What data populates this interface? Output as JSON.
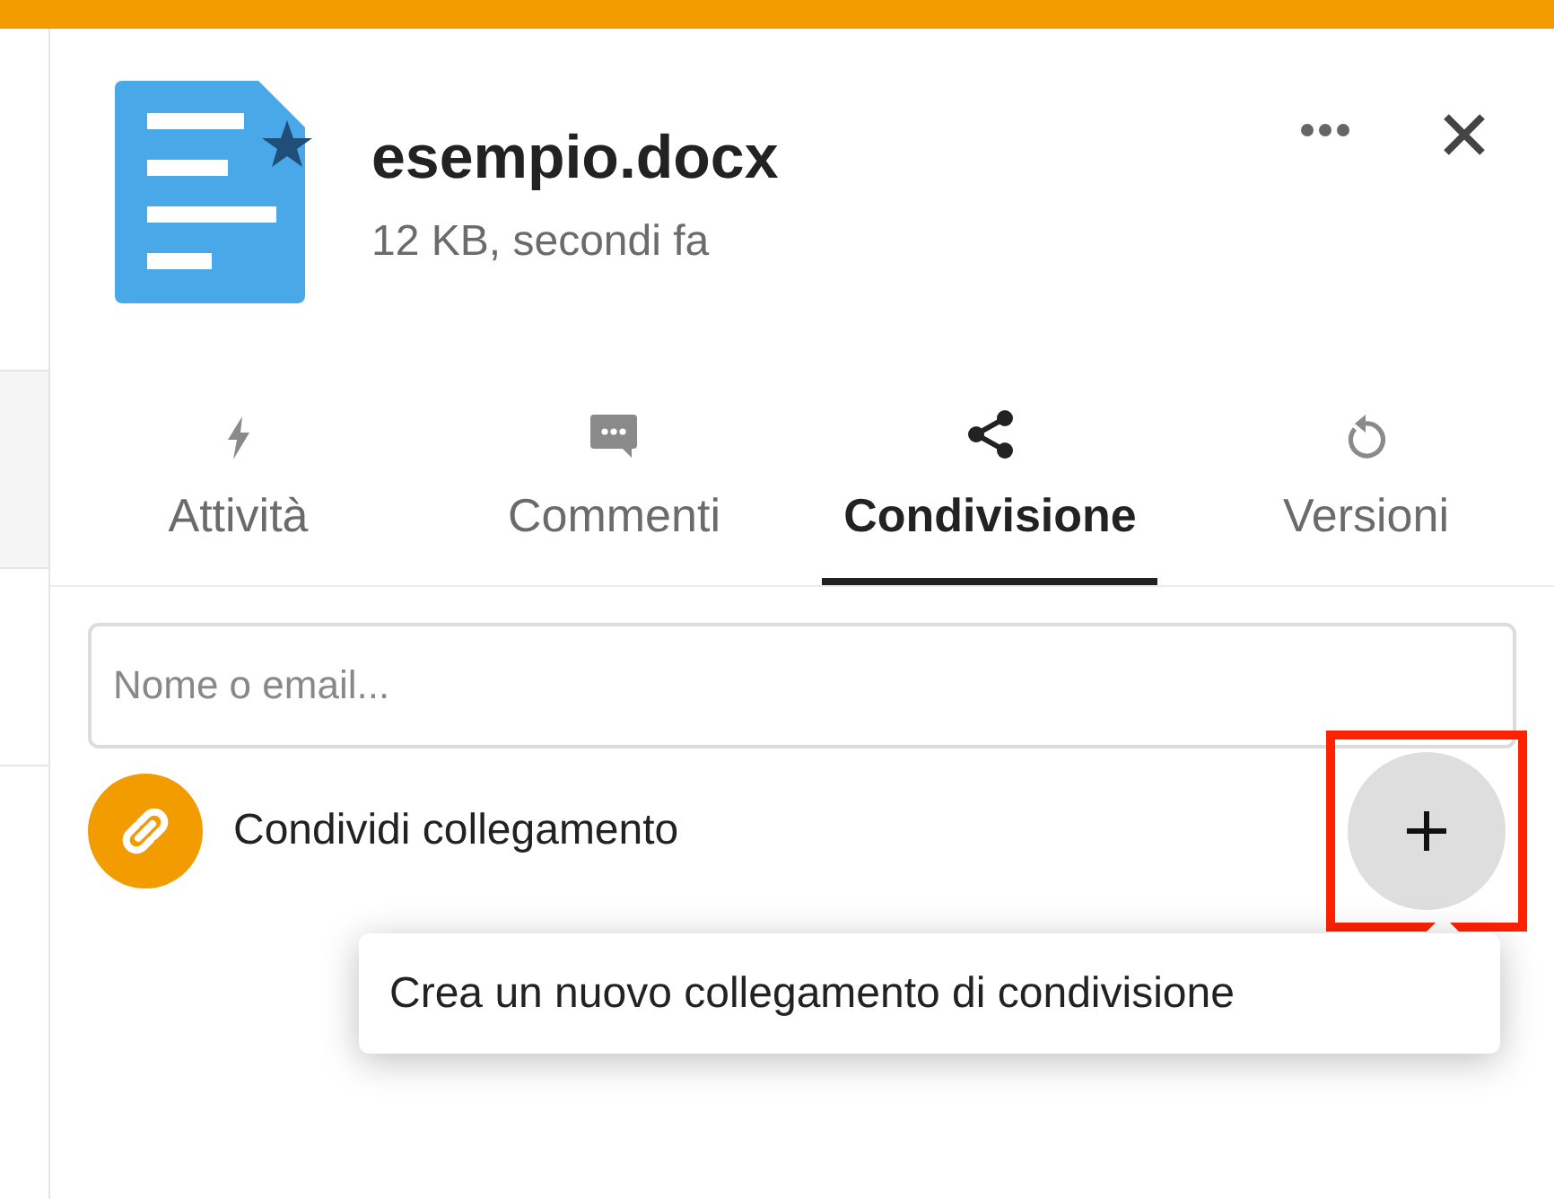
{
  "file": {
    "name": "esempio.docx",
    "meta": "12 KB, secondi fa",
    "favorite": true
  },
  "tabs": [
    {
      "label": "Attività",
      "kind": "activity",
      "selected": false
    },
    {
      "label": "Commenti",
      "kind": "comments",
      "selected": false
    },
    {
      "label": "Condivisione",
      "kind": "sharing",
      "selected": true
    },
    {
      "label": "Versioni",
      "kind": "versions",
      "selected": false
    }
  ],
  "search": {
    "placeholder": "Nome o email..."
  },
  "share_link": {
    "label": "Condividi collegamento",
    "highlighted": true
  },
  "tooltip": {
    "text": "Crea un nuovo collegamento di condivisione"
  }
}
